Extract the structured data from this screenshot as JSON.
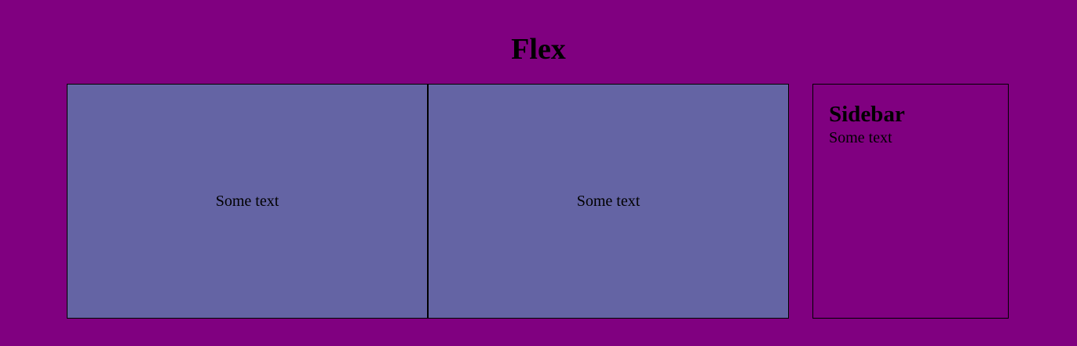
{
  "header": {
    "title": "Flex"
  },
  "main": {
    "boxes": [
      {
        "text": "Some text"
      },
      {
        "text": "Some text"
      }
    ]
  },
  "sidebar": {
    "title": "Sidebar",
    "text": "Some text"
  },
  "colors": {
    "page_background": "#800080",
    "box_background": "#6464a4",
    "border": "#000000"
  }
}
